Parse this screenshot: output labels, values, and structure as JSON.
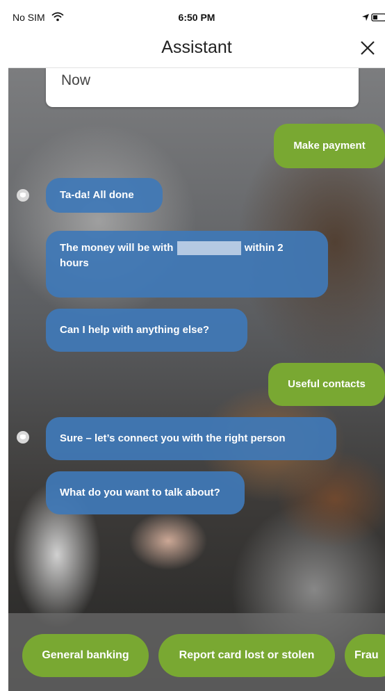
{
  "status_bar": {
    "carrier": "No SIM",
    "time": "6:50 PM"
  },
  "header": {
    "title": "Assistant"
  },
  "chat": {
    "top_card_text": "Now",
    "messages": [
      {
        "from": "user",
        "text": "Make payment"
      },
      {
        "from": "bot",
        "text": "Ta-da! All done"
      },
      {
        "from": "bot",
        "text_before": "The money will be with",
        "text_after": "within 2 hours"
      },
      {
        "from": "bot",
        "text": "Can I help with anything else?"
      },
      {
        "from": "user",
        "text": "Useful contacts"
      },
      {
        "from": "bot",
        "text": "Sure – let’s connect you with the right person"
      },
      {
        "from": "bot",
        "text": "What do you want to talk about?"
      }
    ]
  },
  "quick_replies": [
    "General banking",
    "Report card lost or stolen",
    "Frau"
  ],
  "colors": {
    "bot_bubble": "#3f78b7",
    "user_bubble": "#79a832",
    "quick_reply": "#79a832",
    "header_bg": "#ffffff"
  },
  "icons": {
    "wifi": "wifi-icon",
    "location": "location-icon",
    "battery": "battery-icon",
    "close": "close-icon",
    "bot_avatar": "bot-avatar-icon"
  }
}
